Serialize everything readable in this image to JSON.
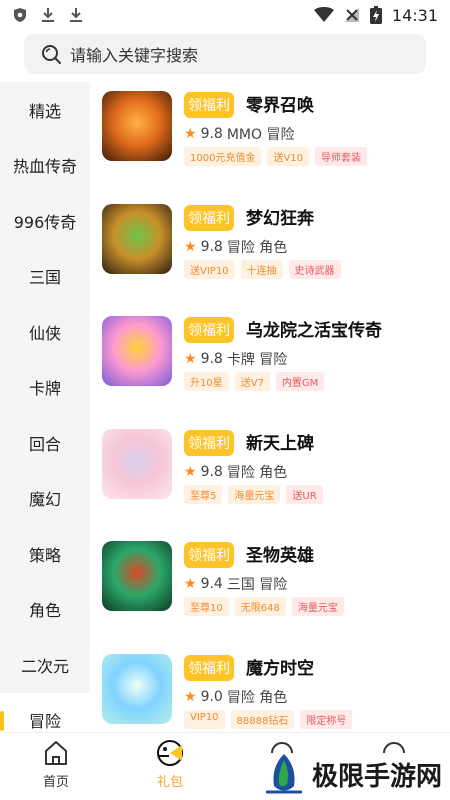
{
  "status": {
    "time": "14:31"
  },
  "search": {
    "placeholder": "请输入关键字搜索"
  },
  "sidebar": {
    "items": [
      {
        "label": "精选"
      },
      {
        "label": "热血传奇"
      },
      {
        "label": "996传奇"
      },
      {
        "label": "三国"
      },
      {
        "label": "仙侠"
      },
      {
        "label": "卡牌"
      },
      {
        "label": "回合"
      },
      {
        "label": "魔幻"
      },
      {
        "label": "策略"
      },
      {
        "label": "角色"
      },
      {
        "label": "二次元"
      },
      {
        "label": "冒险"
      }
    ],
    "active_index": 11
  },
  "games": [
    {
      "name": "零界召唤",
      "welfare": "领福利",
      "rating": "9.8",
      "genre": "MMO 冒险",
      "tags": [
        "1000元充值金",
        "送V10",
        "导师套装"
      ],
      "thumb_colors": [
        "#3a1a0a",
        "#e06a1a",
        "#ffb347"
      ]
    },
    {
      "name": "梦幻狂奔",
      "welfare": "领福利",
      "rating": "9.8",
      "genre": "冒险 角色",
      "tags": [
        "送VIP10",
        "十连抽",
        "史诗武器"
      ],
      "thumb_colors": [
        "#2b1d10",
        "#c8902a",
        "#6fc34a"
      ]
    },
    {
      "name": "乌龙院之活宝传奇",
      "welfare": "领福利",
      "rating": "9.8",
      "genre": "卡牌 冒险",
      "tags": [
        "升10星",
        "送V7",
        "内置GM"
      ],
      "thumb_colors": [
        "#7a5cd8",
        "#ff9ad1",
        "#ffd23a"
      ]
    },
    {
      "name": "新天上碑",
      "welfare": "领福利",
      "rating": "9.8",
      "genre": "冒险 角色",
      "tags": [
        "至尊5",
        "海量元宝",
        "送UR"
      ],
      "thumb_colors": [
        "#fbe7ee",
        "#f6c6d6",
        "#d8d0ee"
      ]
    },
    {
      "name": "圣物英雄",
      "welfare": "领福利",
      "rating": "9.4",
      "genre": "三国 冒险",
      "tags": [
        "至尊10",
        "无限648",
        "海量元宝"
      ],
      "thumb_colors": [
        "#0e3a24",
        "#2aa86a",
        "#d84a2a"
      ]
    },
    {
      "name": "魔方时空",
      "welfare": "领福利",
      "rating": "9.0",
      "genre": "冒险 角色",
      "tags": [
        "VIP10",
        "88888钻石",
        "限定称号"
      ],
      "thumb_colors": [
        "#b6f0e6",
        "#7fd3ff",
        "#f0fff6"
      ]
    }
  ],
  "tabbar": {
    "items": [
      {
        "label": "首页",
        "icon": "home-icon"
      },
      {
        "label": "礼包",
        "icon": "gift-icon",
        "active": true
      },
      {
        "label": "",
        "icon": "tab-icon-3"
      },
      {
        "label": "",
        "icon": "tab-icon-4"
      }
    ]
  },
  "watermark": {
    "text": "极限手游网"
  },
  "colors": {
    "accent": "#ffc32a",
    "active_tab": "#f5a623",
    "star": "#ff8a1c"
  }
}
